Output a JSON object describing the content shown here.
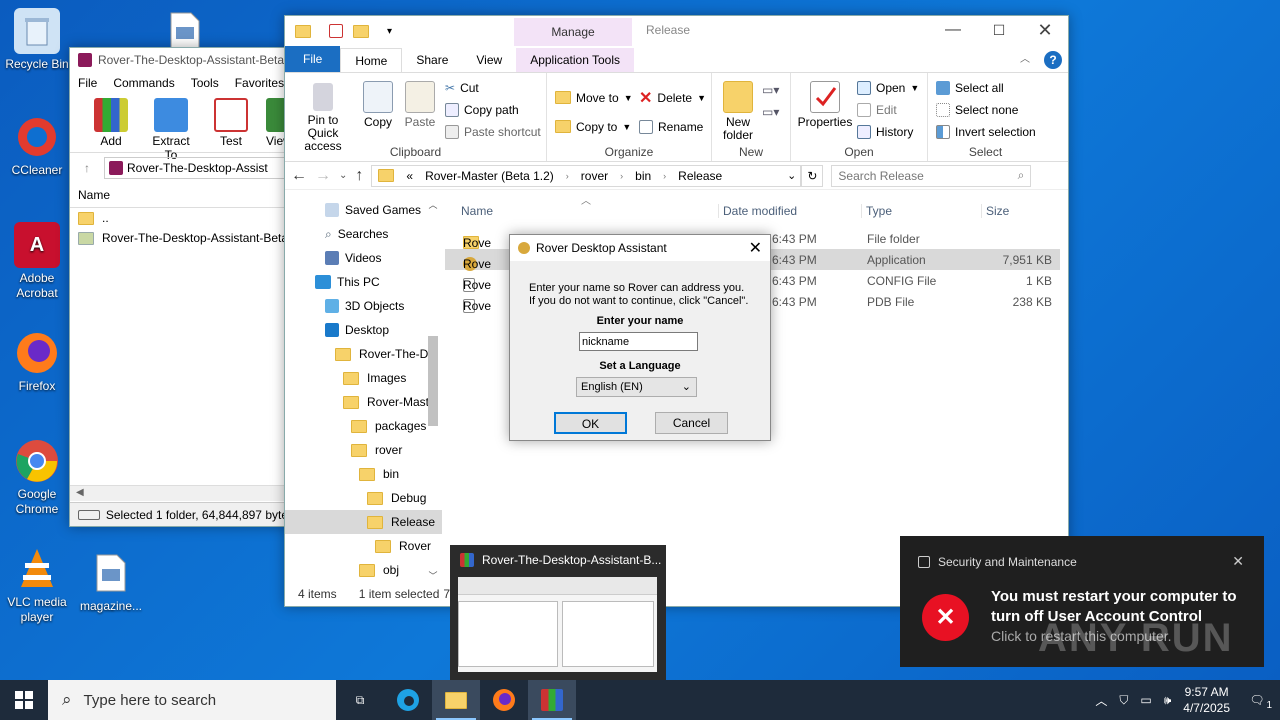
{
  "desktop": {
    "icons": [
      {
        "label": "Recycle Bin"
      },
      {
        "label": "CCleaner"
      },
      {
        "label": "Adobe Acrobat"
      },
      {
        "label": "Firefox"
      },
      {
        "label": "Google Chrome"
      },
      {
        "label": "VLC media player"
      },
      {
        "label": "magazine..."
      }
    ]
  },
  "winrar": {
    "title": "Rover-The-Desktop-Assistant-Beta-",
    "menu": [
      "File",
      "Commands",
      "Tools",
      "Favorites"
    ],
    "toolbar": [
      "Add",
      "Extract To",
      "Test",
      "View"
    ],
    "path": "Rover-The-Desktop-Assist",
    "col_name": "Name",
    "rows": [
      "..",
      "Rover-The-Desktop-Assistant-Beta-1"
    ],
    "status": "Selected 1 folder, 64,844,897 byte"
  },
  "explorer": {
    "title_context": "Manage",
    "title": "Release",
    "tabs": [
      "File",
      "Home",
      "Share",
      "View",
      "Application Tools"
    ],
    "clipboard": {
      "pin": "Pin to Quick access",
      "copy": "Copy",
      "paste": "Paste",
      "cut": "Cut",
      "copy_path": "Copy path",
      "paste_shortcut": "Paste shortcut",
      "label": "Clipboard"
    },
    "organize": {
      "move_to": "Move to",
      "copy_to": "Copy to",
      "delete": "Delete",
      "rename": "Rename",
      "label": "Organize"
    },
    "new": {
      "new_folder": "New folder",
      "label": "New"
    },
    "open": {
      "properties": "Properties",
      "open": "Open",
      "edit": "Edit",
      "history": "History",
      "label": "Open"
    },
    "select": {
      "select_all": "Select all",
      "select_none": "Select none",
      "invert": "Invert selection",
      "label": "Select"
    },
    "breadcrumb": [
      "«",
      "Rover-Master (Beta 1.2)",
      "rover",
      "bin",
      "Release"
    ],
    "search_placeholder": "Search Release",
    "nav": [
      "Saved Games",
      "Searches",
      "Videos",
      "This PC",
      "3D Objects",
      "Desktop",
      "Rover-The-De",
      "Images",
      "Rover-Mast",
      "packages",
      "rover",
      "bin",
      "Debug",
      "Release",
      "Rover",
      "obj"
    ],
    "columns": {
      "name": "Name",
      "date": "Date modified",
      "type": "Type",
      "size": "Size"
    },
    "files": [
      {
        "name": "Rove",
        "date": "5 6:43 PM",
        "type": "File folder",
        "size": ""
      },
      {
        "name": "Rove",
        "date": "5 6:43 PM",
        "type": "Application",
        "size": "7,951 KB"
      },
      {
        "name": "Rove",
        "date": "5 6:43 PM",
        "type": "CONFIG File",
        "size": "1 KB"
      },
      {
        "name": "Rove",
        "date": "5 6:43 PM",
        "type": "PDB File",
        "size": "238 KB"
      }
    ],
    "status_items": "4 items",
    "status_selected": "1 item selected",
    "status_size": "7."
  },
  "dialog": {
    "title": "Rover Desktop Assistant",
    "line1": "Enter your name so Rover can address you.",
    "line2": "If you do not want to continue, click \"Cancel\".",
    "name_label": "Enter your name",
    "name_value": "nickname",
    "lang_label": "Set a Language",
    "lang_value": "English (EN)",
    "ok": "OK",
    "cancel": "Cancel"
  },
  "thumbnail": {
    "title": "Rover-The-Desktop-Assistant-B..."
  },
  "toast": {
    "app": "Security and Maintenance",
    "title": "You must restart your computer to turn off User Account Control",
    "body": "Click to restart this computer.",
    "watermark": "ANY RUN"
  },
  "taskbar": {
    "search_placeholder": "Type here to search",
    "time": "9:57 AM",
    "date": "4/7/2025",
    "notif_count": "1"
  }
}
